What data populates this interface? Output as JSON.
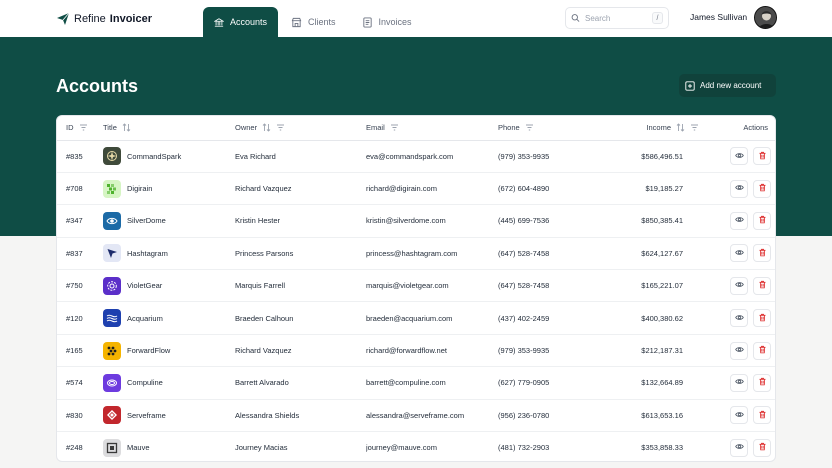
{
  "app": {
    "brand_regular": "Refine",
    "brand_bold": "Invoicer"
  },
  "nav": [
    {
      "label": "Accounts",
      "icon": "bank-icon",
      "active": true
    },
    {
      "label": "Clients",
      "icon": "store-icon",
      "active": false
    },
    {
      "label": "Invoices",
      "icon": "document-icon",
      "active": false
    }
  ],
  "search": {
    "placeholder": "Search",
    "shortcut": "/"
  },
  "user": {
    "name": "James Sullivan"
  },
  "page": {
    "title": "Accounts",
    "add_label": "Add new account"
  },
  "table": {
    "headers": {
      "id": "ID",
      "title": "Title",
      "owner": "Owner",
      "email": "Email",
      "phone": "Phone",
      "income": "Income",
      "actions": "Actions"
    },
    "rows": [
      {
        "id": "#835",
        "title": "CommandSpark",
        "owner": "Eva Richard",
        "email": "eva@commandspark.com",
        "phone": "(979) 353-9935",
        "income": "$586,496.51",
        "icon": "compass-logo-icon",
        "icon_bg": "#3f4a3a",
        "icon_fg": "#e6d9a7"
      },
      {
        "id": "#708",
        "title": "Digirain",
        "owner": "Richard Vazquez",
        "email": "richard@digirain.com",
        "phone": "(672) 604-4890",
        "income": "$19,185.27",
        "icon": "pixel-logo-icon",
        "icon_bg": "#d6f5c4",
        "icon_fg": "#4fb32e"
      },
      {
        "id": "#347",
        "title": "SilverDome",
        "owner": "Kristin Hester",
        "email": "kristin@silverdome.com",
        "phone": "(445) 699-7536",
        "income": "$850,385.41",
        "icon": "eye-logo-icon",
        "icon_bg": "#1c6aa6",
        "icon_fg": "#ffffff"
      },
      {
        "id": "#837",
        "title": "Hashtagram",
        "owner": "Princess Parsons",
        "email": "princess@hashtagram.com",
        "phone": "(647) 528-7458",
        "income": "$624,127.67",
        "icon": "arrow-logo-icon",
        "icon_bg": "#e3e7f5",
        "icon_fg": "#1d2c6b"
      },
      {
        "id": "#750",
        "title": "VioletGear",
        "owner": "Marquis Farrell",
        "email": "marquis@violetgear.com",
        "phone": "(647) 528-7458",
        "income": "$165,221.07",
        "icon": "gear-logo-icon",
        "icon_bg": "#5b2fc9",
        "icon_fg": "#ffffff"
      },
      {
        "id": "#120",
        "title": "Acquarium",
        "owner": "Braeden Calhoun",
        "email": "braeden@acquarium.com",
        "phone": "(437) 402-2459",
        "income": "$400,380.62",
        "icon": "waves-logo-icon",
        "icon_bg": "#1e40af",
        "icon_fg": "#ffffff"
      },
      {
        "id": "#165",
        "title": "ForwardFlow",
        "owner": "Richard Vazquez",
        "email": "richard@forwardflow.net",
        "phone": "(979) 353-9935",
        "income": "$212,187.31",
        "icon": "dots-logo-icon",
        "icon_bg": "#f5b400",
        "icon_fg": "#1f1f1f"
      },
      {
        "id": "#574",
        "title": "Compuline",
        "owner": "Barrett Alvarado",
        "email": "barrett@compuline.com",
        "phone": "(627) 779-0905",
        "income": "$132,664.89",
        "icon": "loop-logo-icon",
        "icon_bg": "#6d3bdf",
        "icon_fg": "#ffffff"
      },
      {
        "id": "#830",
        "title": "Serveframe",
        "owner": "Alessandra Shields",
        "email": "alessandra@serveframe.com",
        "phone": "(956) 236-0780",
        "income": "$613,653.16",
        "icon": "diamond-logo-icon",
        "icon_bg": "#c2272d",
        "icon_fg": "#ffffff"
      },
      {
        "id": "#248",
        "title": "Mauve",
        "owner": "Journey Macias",
        "email": "journey@mauve.com",
        "phone": "(481) 732-2903",
        "income": "$353,858.33",
        "icon": "square-logo-icon",
        "icon_bg": "#dcdcde",
        "icon_fg": "#3a3a3a"
      }
    ]
  },
  "colors": {
    "primary": "#0f4d45",
    "danger": "#dc2626"
  }
}
